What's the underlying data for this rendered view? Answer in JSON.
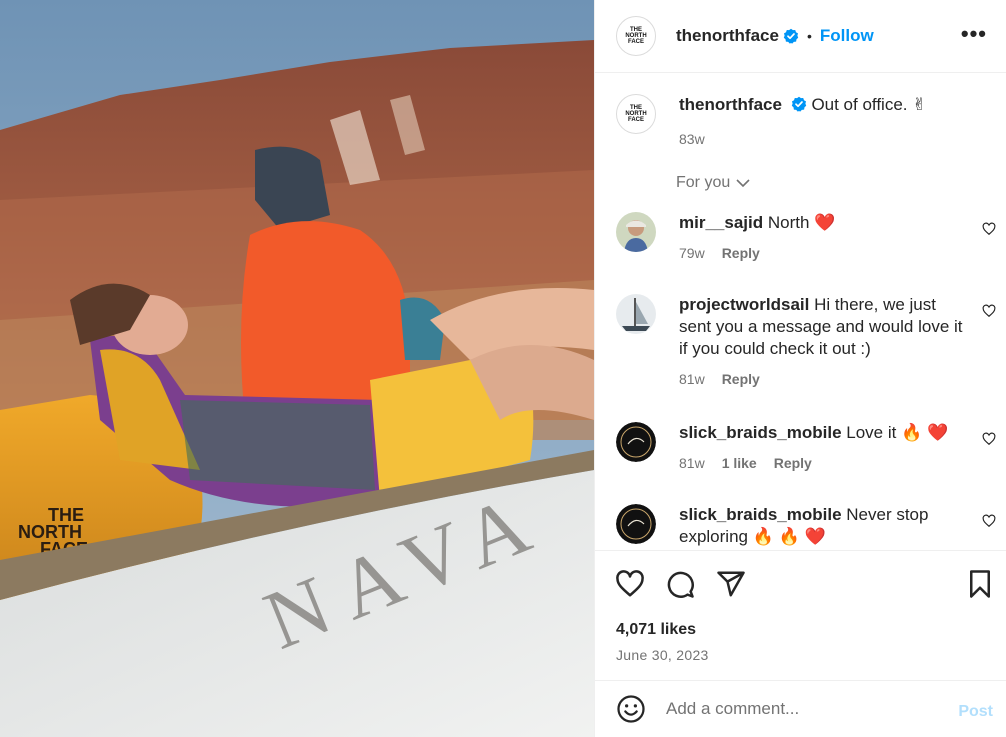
{
  "media": {
    "bag_brand_text": [
      "THE",
      "NORTH",
      "FACE"
    ],
    "boat_lettering": "NAVA"
  },
  "header": {
    "avatar_logo": [
      "THE",
      "NORTH",
      "FACE"
    ],
    "username": "thenorthface",
    "separator": "•",
    "follow_label": "Follow",
    "more_label": "•••"
  },
  "caption": {
    "username": "thenorthface",
    "text": "Out of office. ✌",
    "time": "83w"
  },
  "for_you": {
    "label": "For you"
  },
  "comments": [
    {
      "username": "mir__sajid",
      "text": "North ❤️",
      "time": "79w",
      "likes": "",
      "reply_label": "Reply"
    },
    {
      "username": "projectworldsail",
      "text": "Hi there, we just sent you a message and would love it if you could check it out :)",
      "time": "81w",
      "likes": "",
      "reply_label": "Reply"
    },
    {
      "username": "slick_braids_mobile",
      "text": "Love it 🔥 ❤️",
      "time": "81w",
      "likes": "1 like",
      "reply_label": "Reply"
    },
    {
      "username": "slick_braids_mobile",
      "text": "Never stop exploring 🔥 🔥 ❤️",
      "time": "",
      "likes": "",
      "reply_label": ""
    }
  ],
  "actions": {
    "like_icon": "heart-icon",
    "comment_icon": "comment-icon",
    "share_icon": "share-icon",
    "save_icon": "bookmark-icon"
  },
  "likes_count": "4,071 likes",
  "date": "June 30, 2023",
  "add_comment": {
    "placeholder": "Add a comment...",
    "post_label": "Post",
    "emoji_icon": "smiley-icon"
  },
  "colors": {
    "accent": "#0095f6",
    "post_disabled": "#b2dffc",
    "muted": "#737373",
    "verified": "#0095f6"
  }
}
